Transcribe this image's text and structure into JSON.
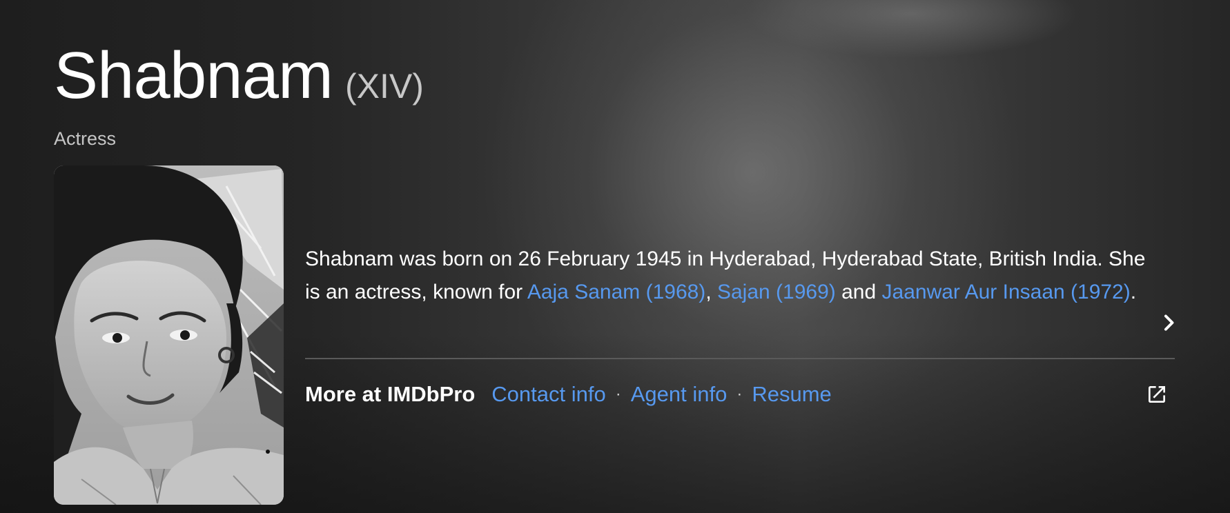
{
  "header": {
    "name": "Shabnam",
    "disambiguation": "(XIV)",
    "role": "Actress"
  },
  "poster": {
    "icon": "actress-portrait-photo"
  },
  "bio": {
    "text_before": "Shabnam was born on 26 February 1945 in Hyderabad, Hyderabad State, British India. She is an actress, known for ",
    "links": [
      "Aaja Sanam (1968)",
      "Sajan (1969)",
      "Jaanwar Aur Insaan (1972)"
    ],
    "sep_comma": ", ",
    "sep_and": " and ",
    "text_after": "."
  },
  "imdbpro": {
    "label": "More at IMDbPro",
    "links": [
      "Contact info",
      "Agent info",
      "Resume"
    ],
    "separator": "·",
    "external_icon": "external-link-icon"
  },
  "colors": {
    "link": "#5799ef",
    "text": "#ffffff",
    "muted": "#c6c6c6"
  }
}
